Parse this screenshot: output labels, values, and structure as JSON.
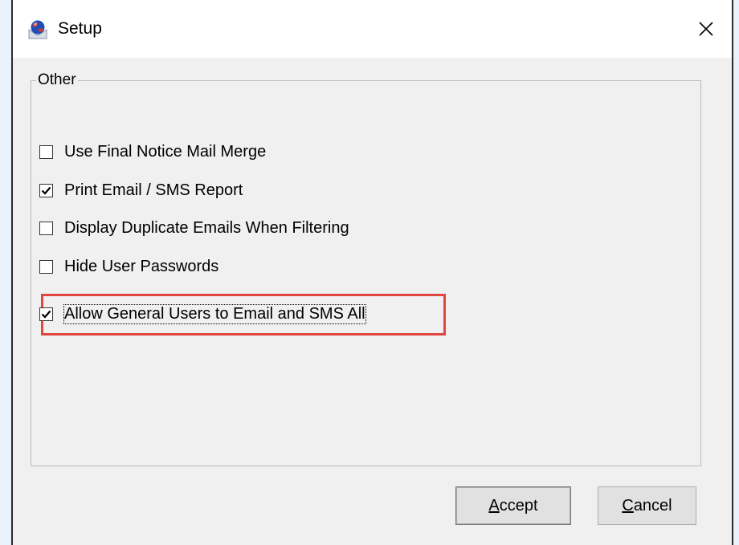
{
  "window": {
    "title": "Setup",
    "app_icon": "mail-globe-icon",
    "close_glyph": "✕"
  },
  "group": {
    "legend": "Other",
    "options": [
      {
        "label": "Use Final Notice Mail Merge",
        "checked": false
      },
      {
        "label": "Print Email / SMS Report",
        "checked": true
      },
      {
        "label": "Display Duplicate Emails When Filtering",
        "checked": false
      },
      {
        "label": "Hide User Passwords",
        "checked": false
      },
      {
        "label": "Allow General Users to Email and SMS All",
        "checked": true,
        "focused": true,
        "highlighted": true
      }
    ]
  },
  "buttons": {
    "accept": "Accept",
    "cancel": "Cancel"
  },
  "colors": {
    "highlight": "#e0473f",
    "dialog_bg": "#f0f0f0",
    "button_bg": "#e1e1e1"
  }
}
